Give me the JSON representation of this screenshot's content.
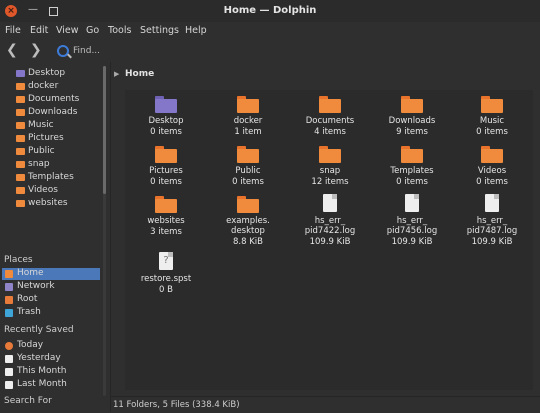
{
  "window": {
    "title": "Home — Dolphin"
  },
  "menubar": {
    "items": [
      "File",
      "Edit",
      "View",
      "Go",
      "Tools",
      "Settings",
      "Help"
    ]
  },
  "toolbar": {
    "find_label": "Find..."
  },
  "colors": {
    "folder": "#f08a3c",
    "folder_dark": "#e9732a",
    "desktop_folder": "#8476c8",
    "selection": "#4a78b8",
    "network": "#8f84c8",
    "root": "#e87a3a",
    "trash": "#3fa5d8"
  },
  "tree": {
    "items": [
      "Desktop",
      "docker",
      "Documents",
      "Downloads",
      "Music",
      "Pictures",
      "Public",
      "snap",
      "Templates",
      "Videos",
      "websites"
    ]
  },
  "places": {
    "title": "Places",
    "items": [
      {
        "label": "Home",
        "icon": "home-icon",
        "selected": true
      },
      {
        "label": "Network",
        "icon": "network-icon",
        "selected": false
      },
      {
        "label": "Root",
        "icon": "root-icon",
        "selected": false
      },
      {
        "label": "Trash",
        "icon": "trash-icon",
        "selected": false
      }
    ]
  },
  "recent": {
    "title": "Recently Saved",
    "items": [
      {
        "label": "Today",
        "icon": "clock-icon"
      },
      {
        "label": "Yesterday",
        "icon": "calendar-icon"
      },
      {
        "label": "This Month",
        "icon": "calendar-icon"
      },
      {
        "label": "Last Month",
        "icon": "calendar-icon"
      }
    ]
  },
  "search_section": {
    "title": "Search For"
  },
  "breadcrumb": {
    "label": "Home"
  },
  "files": [
    {
      "name": "Desktop",
      "sub": "0 items",
      "kind": "desktop-folder"
    },
    {
      "name": "docker",
      "sub": "1 item",
      "kind": "folder"
    },
    {
      "name": "Documents",
      "sub": "4 items",
      "kind": "folder"
    },
    {
      "name": "Downloads",
      "sub": "9 items",
      "kind": "folder"
    },
    {
      "name": "Music",
      "sub": "0 items",
      "kind": "folder"
    },
    {
      "name": "Pictures",
      "sub": "0 items",
      "kind": "folder"
    },
    {
      "name": "Public",
      "sub": "0 items",
      "kind": "folder"
    },
    {
      "name": "snap",
      "sub": "12 items",
      "kind": "folder"
    },
    {
      "name": "Templates",
      "sub": "0 items",
      "kind": "folder"
    },
    {
      "name": "Videos",
      "sub": "0 items",
      "kind": "folder"
    },
    {
      "name": "websites",
      "sub": "3 items",
      "kind": "folder"
    },
    {
      "name": "examples.\ndesktop",
      "sub": "8.8 KiB",
      "kind": "folder"
    },
    {
      "name": "hs_err_\npid7422.log",
      "sub": "109.9 KiB",
      "kind": "document"
    },
    {
      "name": "hs_err_\npid7456.log",
      "sub": "109.9 KiB",
      "kind": "document"
    },
    {
      "name": "hs_err_\npid7487.log",
      "sub": "109.9 KiB",
      "kind": "document"
    },
    {
      "name": "restore.spst",
      "sub": "0 B",
      "kind": "unknown"
    }
  ],
  "status": {
    "text": "11 Folders, 5 Files (338.4 KiB)"
  }
}
